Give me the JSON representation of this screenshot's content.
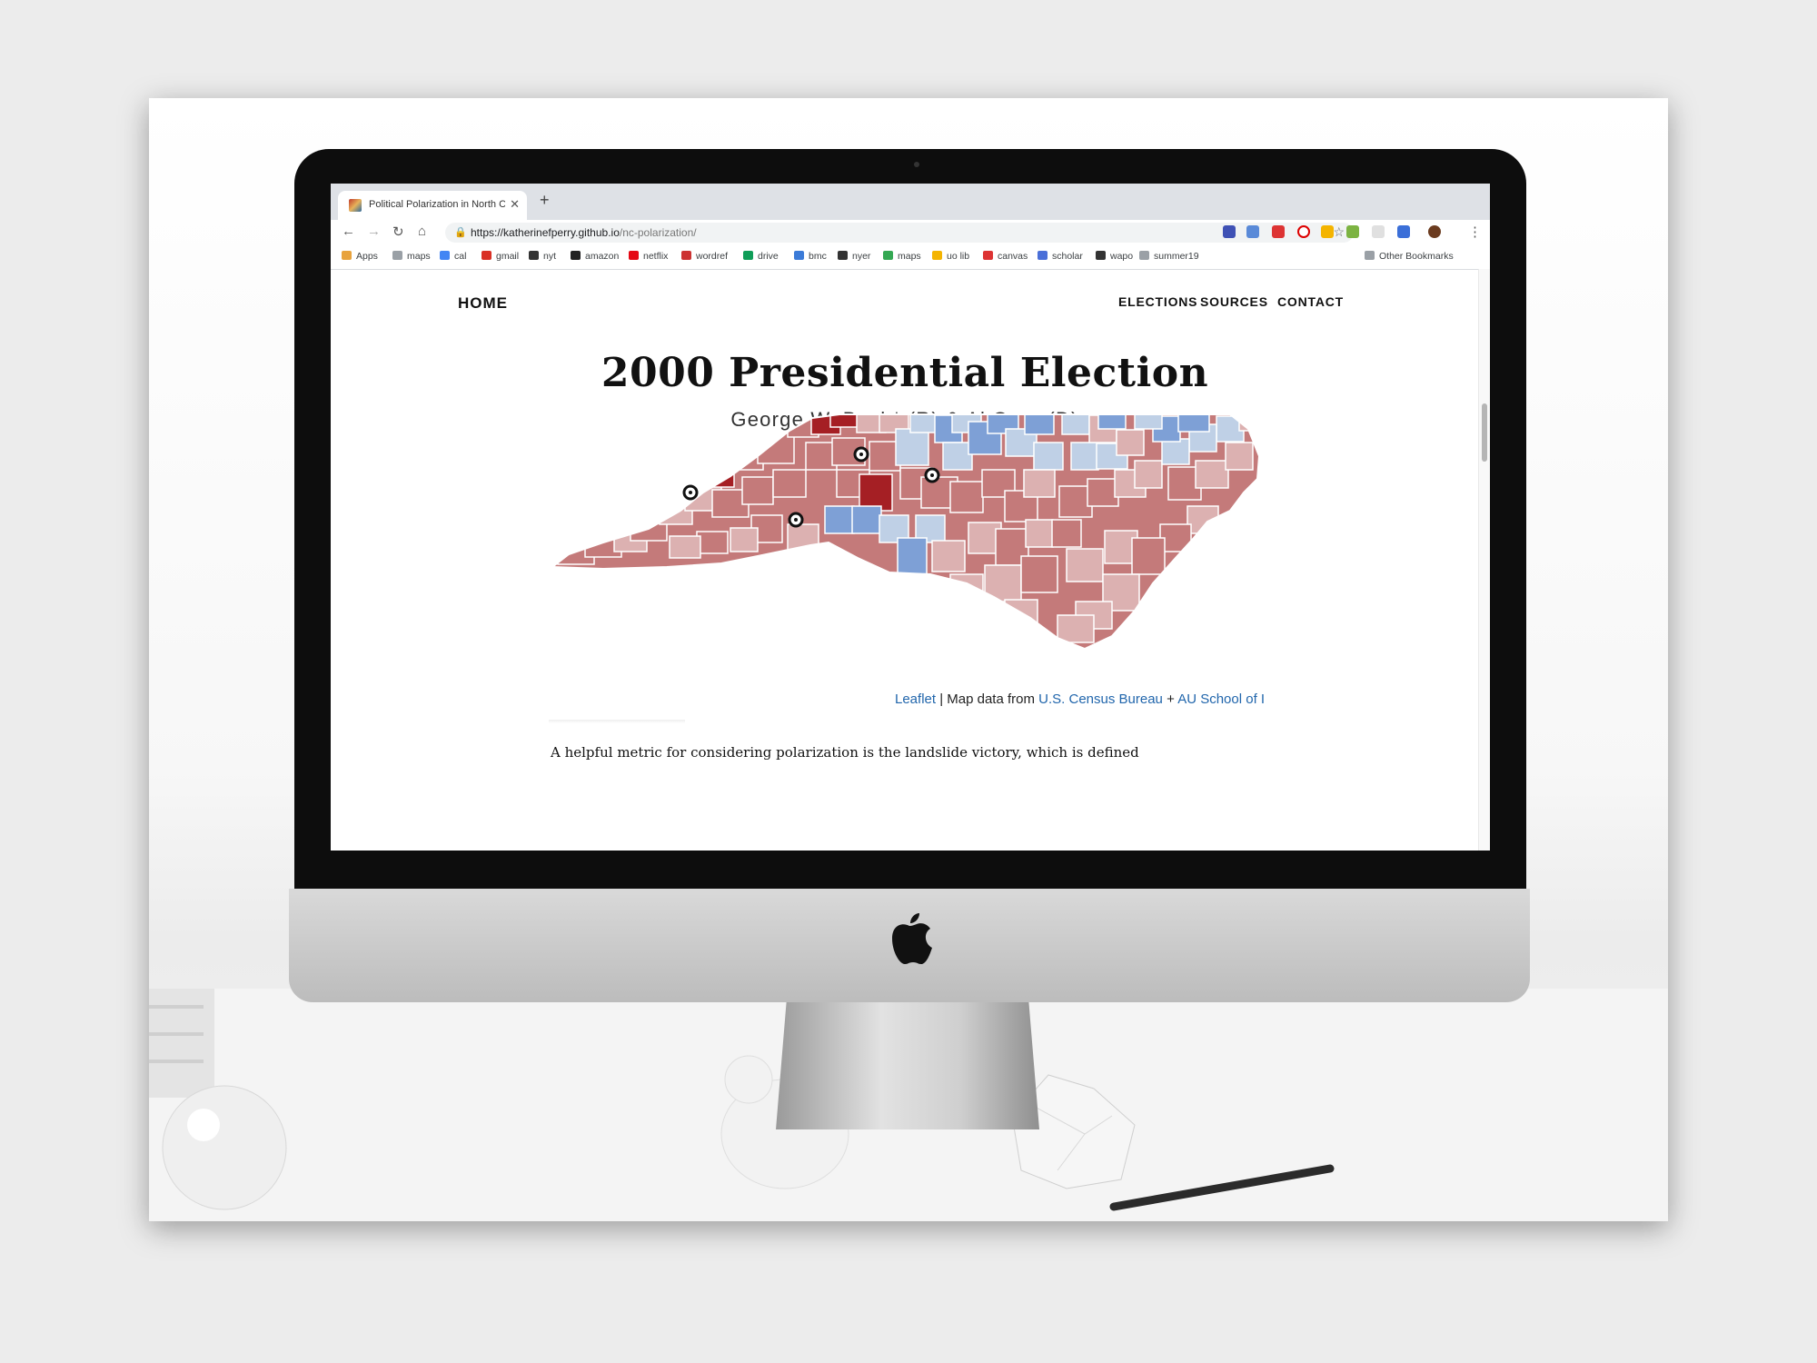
{
  "browser": {
    "tab_title": "Political Polarization in North C",
    "url_host": "https://katherinefperry.github.io",
    "url_path": "/nc-polarization/",
    "bookmarks": [
      "Apps",
      "maps",
      "cal",
      "gmail",
      "nyt",
      "amazon",
      "netflix",
      "wordref",
      "drive",
      "bmc",
      "nyer",
      "maps",
      "uo lib",
      "canvas",
      "scholar",
      "wapo",
      "summer19"
    ],
    "other_bookmarks": "Other Bookmarks"
  },
  "site": {
    "home": "HOME",
    "nav": [
      "ELECTIONS",
      "SOURCES",
      "CONTACT"
    ]
  },
  "page": {
    "title": "2000 Presidential Election",
    "subtitle": "George W. Bush* (R) & Al Gore (D)",
    "body_text": "A helpful metric for considering polarization is the landslide victory, which is defined"
  },
  "map": {
    "attribution_leaflet": "Leaflet",
    "attribution_sep": " | Map data from ",
    "attribution_census": "U.S. Census Bureau",
    "attribution_plus": " + ",
    "attribution_au": "AU School of I",
    "colors": {
      "strong_rep": "#a51f24",
      "rep": "#c47a7a",
      "lean_rep": "#dcb1b1",
      "lean_dem": "#bfd0e6",
      "dem": "#7ea0d6",
      "border": "#ffffff"
    }
  }
}
